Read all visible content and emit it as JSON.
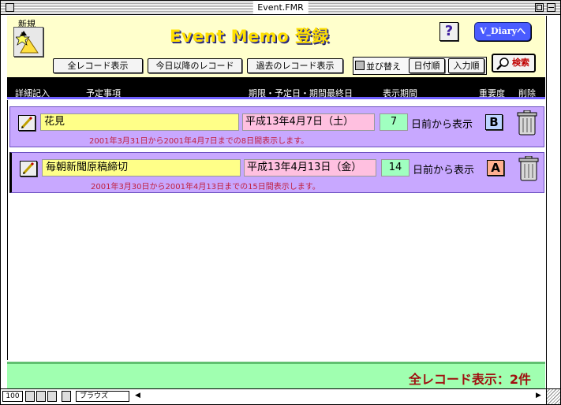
{
  "window": {
    "title": "Event.FMR"
  },
  "header": {
    "new_label": "新規",
    "app_title": "Event Memo 登録",
    "help_label": "?",
    "diary_label": "V_Diaryへ"
  },
  "toolbar": {
    "all_records": "全レコード表示",
    "today_onward": "今日以降のレコード",
    "past_records": "過去のレコード表示",
    "sort_label": "並び替え",
    "sort_by_date": "日付順",
    "sort_by_input": "入力順",
    "search_label": "検索"
  },
  "columns": {
    "detail": "詳細記入",
    "event": "予定事項",
    "deadline": "期限・予定日・期間最終日",
    "period": "表示期間",
    "priority": "重要度",
    "delete": "削除"
  },
  "records": [
    {
      "title": "花見",
      "date": "平成13年4月7日（土）",
      "days": "7",
      "days_label": "日前から表示",
      "priority": "B",
      "note": "2001年3月31日から2001年4月7日までの8日間表示します。"
    },
    {
      "title": "毎朝新聞原稿締切",
      "date": "平成13年4月13日（金）",
      "days": "14",
      "days_label": "日前から表示",
      "priority": "A",
      "note": "2001年3月30日から2001年4月13日までの15日間表示します。"
    }
  ],
  "footer": {
    "status": "全レコード表示：2件"
  },
  "statusbar": {
    "zoom": "100",
    "mode": "ブラウズ"
  }
}
